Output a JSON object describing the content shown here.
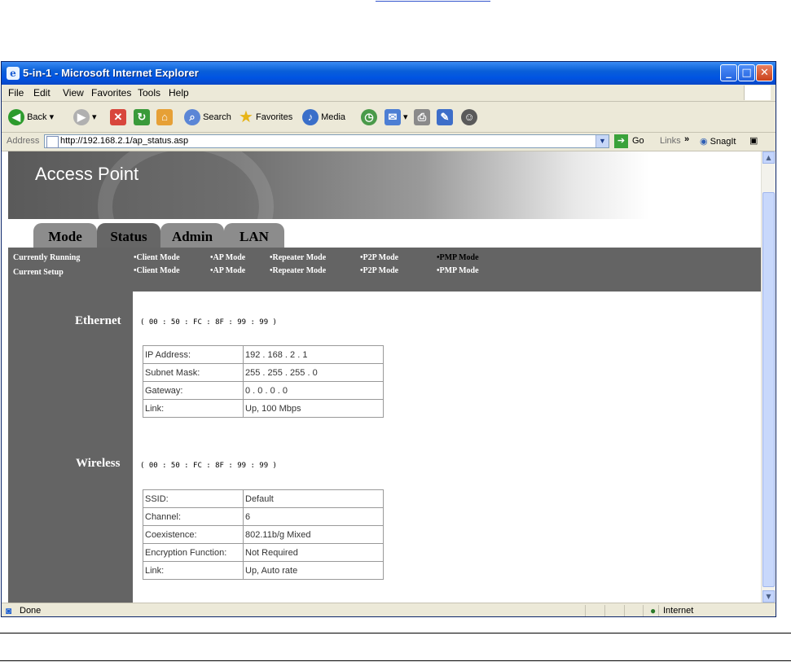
{
  "window": {
    "title": "5-in-1 - Microsoft Internet Explorer",
    "icon": "ie-icon"
  },
  "menu": [
    "File",
    "Edit",
    "View",
    "Favorites",
    "Tools",
    "Help"
  ],
  "toolbar": {
    "back": "Back",
    "search": "Search",
    "favorites": "Favorites",
    "media": "Media"
  },
  "address": {
    "label": "Address",
    "url": "http://192.168.2.1/ap_status.asp",
    "go": "Go",
    "links": "Links",
    "links_more": "»",
    "snagit": "SnagIt"
  },
  "page": {
    "banner_title": "Access Point",
    "tabs": [
      "Mode",
      "Status",
      "Admin",
      "LAN"
    ],
    "modes": {
      "currently_running_label": "Currently Running",
      "current_setup_label": "Current Setup",
      "running": [
        "•Client Mode",
        "•AP Mode",
        "•Repeater Mode",
        "•P2P Mode",
        "•PMP Mode"
      ],
      "setup": [
        "•Client Mode",
        "•AP Mode",
        "•Repeater Mode",
        "•P2P Mode",
        "•PMP Mode"
      ]
    },
    "ethernet": {
      "heading": "Ethernet",
      "mac": "( 00 : 50 : FC : 8F : 99 : 99 )",
      "rows": [
        {
          "label": "IP Address:",
          "value": "192 . 168 . 2 . 1"
        },
        {
          "label": "Subnet Mask:",
          "value": "255 . 255 . 255 . 0"
        },
        {
          "label": "Gateway:",
          "value": "0 . 0 . 0 . 0"
        },
        {
          "label": "Link:",
          "value": "Up, 100 Mbps"
        }
      ]
    },
    "wireless": {
      "heading": "Wireless",
      "mac": "( 00 : 50 : FC : 8F : 99 : 99 )",
      "rows": [
        {
          "label": "SSID:",
          "value": "Default"
        },
        {
          "label": "Channel:",
          "value": "6"
        },
        {
          "label": "Coexistence:",
          "value": "802.11b/g Mixed"
        },
        {
          "label": "Encryption Function:",
          "value": "Not Required"
        },
        {
          "label": "Link:",
          "value": "Up,  Auto rate"
        }
      ]
    }
  },
  "status": {
    "text": "Done",
    "zone": "Internet"
  }
}
